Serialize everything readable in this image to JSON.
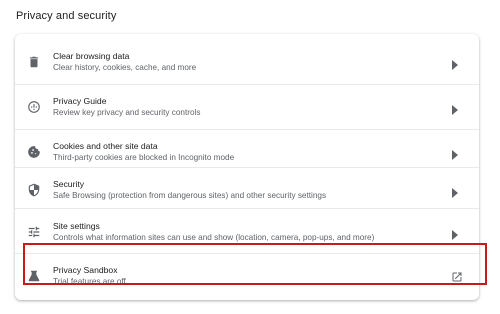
{
  "section": {
    "title": "Privacy and security"
  },
  "rows": [
    {
      "title": "Clear browsing data",
      "subtitle": "Clear history, cookies, cache, and more",
      "icon": "trash-icon"
    },
    {
      "title": "Privacy Guide",
      "subtitle": "Review key privacy and security controls",
      "icon": "privacy-guide-icon"
    },
    {
      "title": "Cookies and other site data",
      "subtitle": "Third-party cookies are blocked in Incognito mode",
      "icon": "cookie-icon"
    },
    {
      "title": "Security",
      "subtitle": "Safe Browsing (protection from dangerous sites) and other security settings",
      "icon": "shield-icon"
    },
    {
      "title": "Site settings",
      "subtitle": "Controls what information sites can use and show (location, camera, pop-ups, and more)",
      "icon": "tune-icon"
    },
    {
      "title": "Privacy Sandbox",
      "subtitle": "Trial features are off",
      "icon": "flask-icon"
    }
  ],
  "colors": {
    "highlight": "#c61b1b",
    "icon": "#5f6368",
    "divider": "#e8eaed"
  }
}
